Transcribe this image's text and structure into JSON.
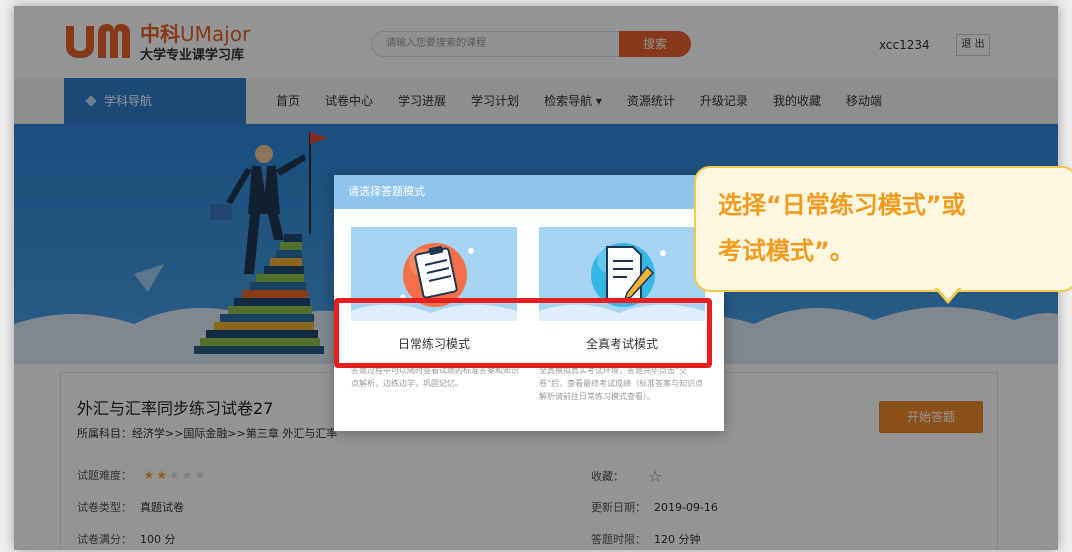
{
  "header": {
    "logo_brand": "中科",
    "logo_brand_en": "UMajor",
    "logo_subtitle": "大学专业课学习库",
    "search_placeholder": "请输入您要搜索的课程",
    "search_button": "搜索",
    "username": "xcc1234",
    "logout_label": "退 出"
  },
  "nav": {
    "subject_label": "学科导航",
    "items": [
      "首页",
      "试卷中心",
      "学习进展",
      "学习计划",
      "检索导航 ▾",
      "资源统计",
      "升级记录",
      "我的收藏",
      "移动端"
    ]
  },
  "paper": {
    "title": "外汇与汇率同步练习试卷27",
    "subject_path": "所属科目：经济学>>国际金融>>第三章 外汇与汇率",
    "start_button": "开始答题",
    "difficulty_label": "试题难度：",
    "difficulty_stars": 2,
    "difficulty_max": 5,
    "type_label": "试卷类型：",
    "type_value": "真题试卷",
    "full_score_label": "试卷满分：",
    "full_score_value": "100 分",
    "favorite_label": "收藏：",
    "updated_label": "更新日期：",
    "updated_value": "2019-09-16",
    "time_label": "答题时限：",
    "time_value": "120 分钟"
  },
  "modal": {
    "title": "请选择答题模式",
    "modes": [
      {
        "label": "日常练习模式",
        "desc": "答题过程中可以随时查看试题的标准答案和知识点解析，边练边学，巩固记忆。"
      },
      {
        "label": "全真考试模式",
        "desc": "全真模拟真实考试环境，答题完毕点击“交卷”后，查看最终考试成绩（标准答案与知识点解析请前往日常练习模式查看）。"
      }
    ]
  },
  "callout": {
    "line1": "选择“日常练习模式”或",
    "line2": "考试模式”。"
  },
  "colors": {
    "brand_orange": "#e8612c",
    "nav_blue": "#2f7fce",
    "start_button": "#f08a2a",
    "highlight_red": "#e51e1e",
    "callout_text": "#f49b1d"
  }
}
